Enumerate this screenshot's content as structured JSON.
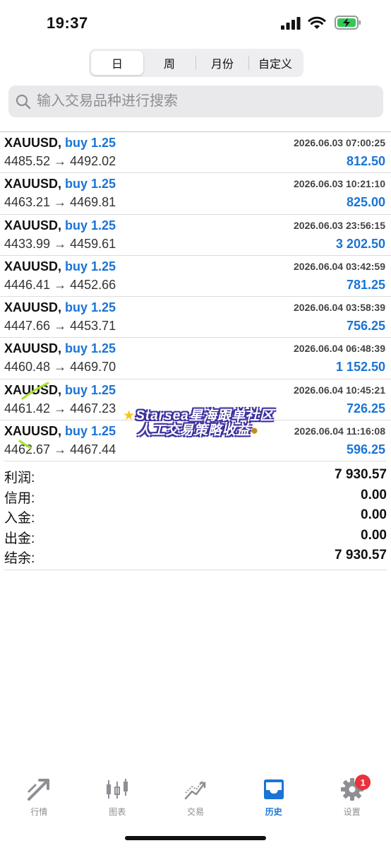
{
  "status": {
    "time": "19:37"
  },
  "period_tabs": [
    {
      "label": "日",
      "active": true
    },
    {
      "label": "周",
      "active": false
    },
    {
      "label": "月份",
      "active": false
    },
    {
      "label": "自定义",
      "active": false
    }
  ],
  "search": {
    "placeholder": "输入交易品种进行搜索"
  },
  "deals": [
    {
      "symbol": "XAUUSD,",
      "side": "buy 1.25",
      "time": "2026.06.03 07:00:25",
      "prices": "4485.52 → 4492.02",
      "profit": "812.50"
    },
    {
      "symbol": "XAUUSD,",
      "side": "buy 1.25",
      "time": "2026.06.03 10:21:10",
      "prices": "4463.21 → 4469.81",
      "profit": "825.00"
    },
    {
      "symbol": "XAUUSD,",
      "side": "buy 1.25",
      "time": "2026.06.03 23:56:15",
      "prices": "4433.99 → 4459.61",
      "profit": "3 202.50"
    },
    {
      "symbol": "XAUUSD,",
      "side": "buy 1.25",
      "time": "2026.06.04 03:42:59",
      "prices": "4446.41 → 4452.66",
      "profit": "781.25"
    },
    {
      "symbol": "XAUUSD,",
      "side": "buy 1.25",
      "time": "2026.06.04 03:58:39",
      "prices": "4447.66 → 4453.71",
      "profit": "756.25"
    },
    {
      "symbol": "XAUUSD,",
      "side": "buy 1.25",
      "time": "2026.06.04 06:48:39",
      "prices": "4460.48 → 4469.70",
      "profit": "1 152.50"
    },
    {
      "symbol": "XAUUSD,",
      "side": "buy 1.25",
      "time": "2026.06.04 10:45:21",
      "prices": "4461.42 → 4467.23",
      "profit": "726.25"
    },
    {
      "symbol": "XAUUSD,",
      "side": "buy 1.25",
      "time": "2026.06.04 11:16:08",
      "prices": "4462.67 → 4467.44",
      "profit": "596.25"
    }
  ],
  "summary": [
    {
      "label": "利润:",
      "value": "7 930.57"
    },
    {
      "label": "信用:",
      "value": "0.00"
    },
    {
      "label": "入金:",
      "value": "0.00"
    },
    {
      "label": "出金:",
      "value": "0.00"
    },
    {
      "label": "结余:",
      "value": "7 930.57"
    }
  ],
  "watermark": {
    "line1": "Starsea星海跟单社区",
    "line2": "人工交易策略收益"
  },
  "tabbar": [
    {
      "label": "行情",
      "icon": "trend-arrows-icon",
      "active": false
    },
    {
      "label": "图表",
      "icon": "candlestick-icon",
      "active": false
    },
    {
      "label": "交易",
      "icon": "trade-chart-icon",
      "active": false
    },
    {
      "label": "历史",
      "icon": "inbox-tray-icon",
      "active": true
    },
    {
      "label": "设置",
      "icon": "gear-icon",
      "active": false,
      "badge": "1"
    }
  ],
  "colors": {
    "accent": "#1a74d6",
    "badge": "#e8323c",
    "battery": "#34c759"
  }
}
